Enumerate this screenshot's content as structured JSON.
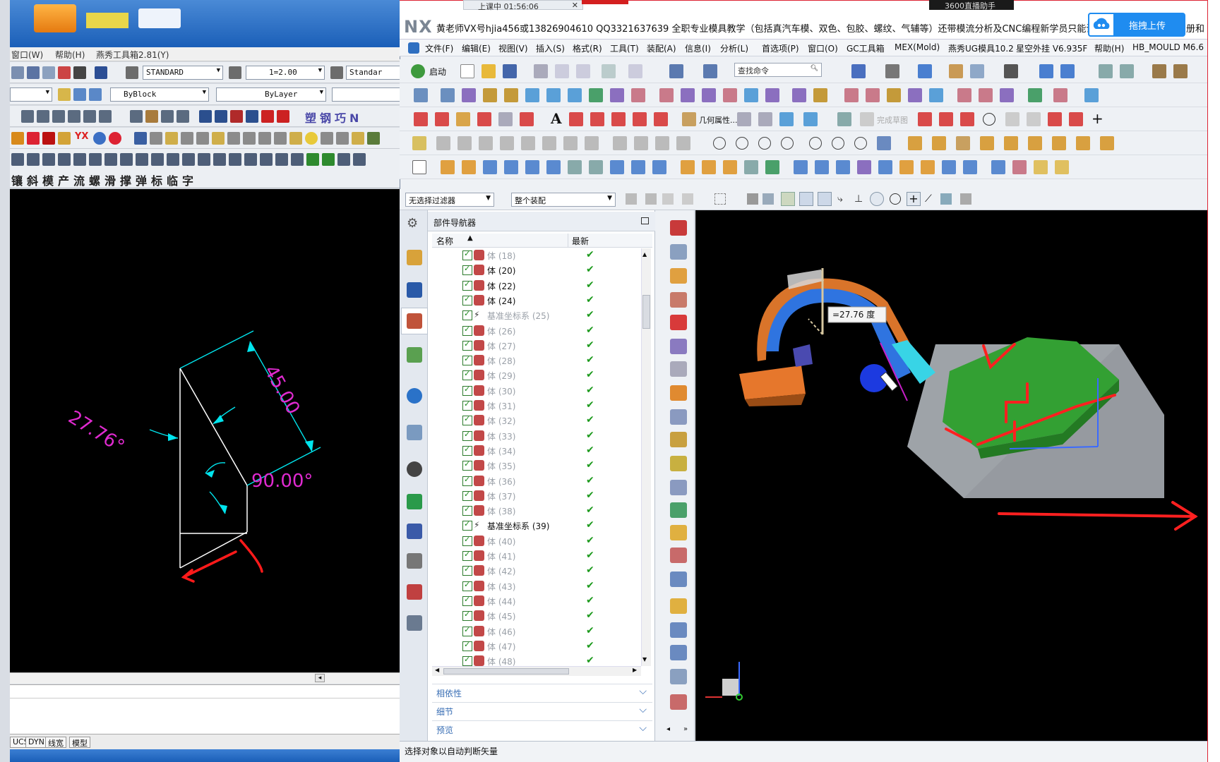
{
  "cad": {
    "menubar": [
      "窗口(W)",
      "帮助(H)",
      "燕秀工具箱2.81(Y)"
    ],
    "text_style": "STANDARD",
    "dim_scale": "1=2.00",
    "dim_style_clipped": "Standar",
    "color_control": "ByBlock",
    "linetype_control": "ByLayer",
    "chinese_tools": [
      "镶",
      "斜",
      "模",
      "产",
      "流",
      "螺",
      "滑",
      "撑",
      "弹",
      "标",
      "临",
      "字"
    ],
    "status_tabs": [
      "UCS",
      "DYN",
      "线宽",
      "模型"
    ],
    "drawing": {
      "angle_label": "27.76°",
      "length_label": "45.00",
      "right_angle_label": "90.00°"
    },
    "colors": {
      "canvas": "#000000",
      "geometry": "#ffffff",
      "dimension": "#00e5ee",
      "dim_text": "#e02ad0",
      "annotation": "#ff1a1a"
    }
  },
  "nx": {
    "top_tab": "上课中 01:56:06",
    "top_right": "3600直播助手",
    "logo": "NX",
    "title": "黄老师VX号hjia456或13826904610 QQ3321637639 全职专业模具教学（包括真汽车模、双色、包胶、螺纹、气辅等）还带模流分析及CNC编程新学员只能试听，",
    "title_suffix": "册和",
    "upload_label": "拖拽上传",
    "menubar": [
      "文件(F)",
      "编辑(E)",
      "视图(V)",
      "插入(S)",
      "格式(R)",
      "工具(T)",
      "装配(A)",
      "信息(I)",
      "分析(L)",
      "首选项(P)",
      "窗口(O)",
      "GC工具箱",
      "MEX(Mold)",
      "燕秀UG模具10.2",
      "星空外挂 V6.935F",
      "帮助(H)",
      "HB_MOULD M6.6"
    ],
    "start_label": "启动",
    "search_placeholder": "查找命令",
    "toolbar_text_1": "几何属性...",
    "toolbar_text_2": "完成草图",
    "selection_filter": "无选择过滤器",
    "assembly_scope": "整个装配",
    "navigator": {
      "title": "部件导航器",
      "col_name": "名称",
      "col_latest": "最新",
      "rows": [
        {
          "label": "体 (18)",
          "dim": true
        },
        {
          "label": "体 (20)",
          "dim": false
        },
        {
          "label": "体 (22)",
          "dim": false
        },
        {
          "label": "体 (24)",
          "dim": false
        },
        {
          "label": "基准坐标系 (25)",
          "dim": true,
          "datum": true
        },
        {
          "label": "体 (26)",
          "dim": true
        },
        {
          "label": "体 (27)",
          "dim": true
        },
        {
          "label": "体 (28)",
          "dim": true
        },
        {
          "label": "体 (29)",
          "dim": true
        },
        {
          "label": "体 (30)",
          "dim": true
        },
        {
          "label": "体 (31)",
          "dim": true
        },
        {
          "label": "体 (32)",
          "dim": true
        },
        {
          "label": "体 (33)",
          "dim": true
        },
        {
          "label": "体 (34)",
          "dim": true
        },
        {
          "label": "体 (35)",
          "dim": true
        },
        {
          "label": "体 (36)",
          "dim": true
        },
        {
          "label": "体 (37)",
          "dim": true
        },
        {
          "label": "体 (38)",
          "dim": true
        },
        {
          "label": "基准坐标系 (39)",
          "dim": false,
          "datum": true
        },
        {
          "label": "体 (40)",
          "dim": true
        },
        {
          "label": "体 (41)",
          "dim": true
        },
        {
          "label": "体 (42)",
          "dim": true
        },
        {
          "label": "体 (43)",
          "dim": true
        },
        {
          "label": "体 (44)",
          "dim": true
        },
        {
          "label": "体 (45)",
          "dim": true
        },
        {
          "label": "体 (46)",
          "dim": true
        },
        {
          "label": "体 (47)",
          "dim": true
        },
        {
          "label": "体 (48)",
          "dim": true
        }
      ],
      "sections": [
        "相依性",
        "细节",
        "预览"
      ]
    },
    "graphics": {
      "angle_readout": "=27.76 度"
    },
    "status_text": "选择对象以自动判断矢量"
  }
}
